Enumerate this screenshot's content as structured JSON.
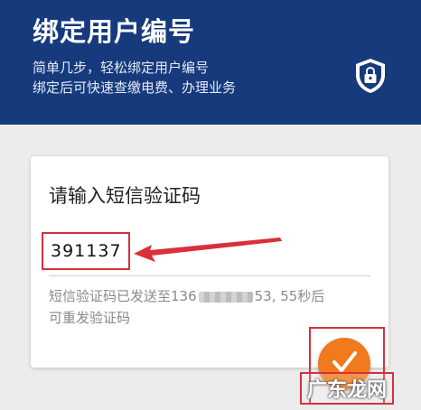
{
  "header": {
    "title": "绑定用户编号",
    "subtitle_line1": "简单几步，轻松绑定用户编号",
    "subtitle_line2": "绑定后可快速查缴电费、办理业务",
    "icon": "shield-lock-icon"
  },
  "card": {
    "title": "请输入短信验证码",
    "code_value": "391137",
    "hint_prefix": "短信验证码已发送至136",
    "hint_suffix": "53, 55秒后",
    "hint_line2": "可重发验证码"
  },
  "confirm": {
    "icon": "check-icon",
    "color": "#f07a1c"
  },
  "watermark": {
    "text": "广东龙网"
  },
  "colors": {
    "header_bg": "#163a7c",
    "highlight": "#d9303a",
    "confirm": "#f07a1c"
  }
}
